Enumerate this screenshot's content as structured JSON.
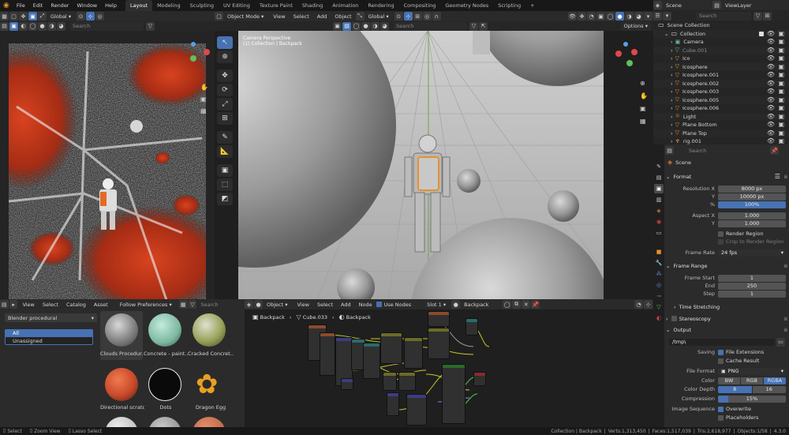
{
  "topbar": {
    "menus": [
      "File",
      "Edit",
      "Render",
      "Window",
      "Help"
    ],
    "workspaces": [
      "Layout",
      "Modeling",
      "Sculpting",
      "UV Editing",
      "Texture Paint",
      "Shading",
      "Animation",
      "Rendering",
      "Compositing",
      "Geometry Nodes",
      "Scripting"
    ],
    "plus": "+",
    "scene": "Scene",
    "view_layer": "ViewLayer"
  },
  "image_editor": {
    "orientation": "Global",
    "search_placeholder": "Search"
  },
  "viewport": {
    "mode": "Object Mode",
    "menus": [
      "View",
      "Select",
      "Add",
      "Object"
    ],
    "orientation": "Global",
    "search_placeholder": "Search",
    "options": "Options",
    "overlay_title": "Camera Perspective",
    "overlay_subtitle": "(1) Collection | Backpack"
  },
  "asset_browser": {
    "menus": [
      "View",
      "Select",
      "Catalog",
      "Asset"
    ],
    "follow_prefs": "Follow Preferences",
    "search_placeholder": "Search",
    "library": "Blender procedural",
    "catalogs": [
      "All",
      "Unassigned"
    ],
    "assets": [
      {
        "name": "Clouds Procedur...",
        "color": "#9a9a9a"
      },
      {
        "name": "Concrete - paint...",
        "color": "#8fc7b0"
      },
      {
        "name": "Cracked Concret...",
        "color": "#9aa35a"
      },
      {
        "name": "Directional scratc...",
        "color": "#c94a2a"
      },
      {
        "name": "Dots",
        "color": "#111111"
      },
      {
        "name": "Dragon Egg",
        "color": "#e8a020"
      }
    ]
  },
  "node_editor": {
    "type": "Object",
    "menus": [
      "View",
      "Select",
      "Add",
      "Node"
    ],
    "use_nodes": "Use Nodes",
    "slot": "Slot 1",
    "material": "Backpack",
    "breadcrumbs": [
      "Backpack",
      "Cube.033",
      "Backpack"
    ]
  },
  "outliner": {
    "search_placeholder": "Search",
    "root": "Scene Collection",
    "collection": "Collection",
    "items": [
      {
        "name": "Camera",
        "icon": "camera-icon",
        "color": "#6fb4a3"
      },
      {
        "name": "Cube.001",
        "icon": "mesh-icon",
        "color": "#6fb4a3",
        "dim": true
      },
      {
        "name": "Ico",
        "icon": "mesh-icon",
        "color": "#e8902e"
      },
      {
        "name": "Icosphere",
        "icon": "mesh-icon",
        "color": "#e8902e"
      },
      {
        "name": "Icosphere.001",
        "icon": "mesh-icon",
        "color": "#e8902e"
      },
      {
        "name": "Icosphere.002",
        "icon": "mesh-icon",
        "color": "#e8902e"
      },
      {
        "name": "Icosphere.003",
        "icon": "mesh-icon",
        "color": "#e8902e"
      },
      {
        "name": "Icosphere.005",
        "icon": "mesh-icon",
        "color": "#e8902e"
      },
      {
        "name": "Icosphere.006",
        "icon": "mesh-icon",
        "color": "#e8902e"
      },
      {
        "name": "Light",
        "icon": "light-icon",
        "color": "#e8902e"
      },
      {
        "name": "Plane Bottom",
        "icon": "mesh-icon",
        "color": "#e8902e"
      },
      {
        "name": "Plane Top",
        "icon": "mesh-icon",
        "color": "#e8902e"
      },
      {
        "name": "rig.001",
        "icon": "armature-icon",
        "color": "#e8902e"
      }
    ]
  },
  "properties": {
    "search_placeholder": "Search",
    "breadcrumb": "Scene",
    "format": {
      "title": "Format",
      "resolution_x_label": "Resolution X",
      "resolution_x": "8000 px",
      "y_label": "Y",
      "resolution_y": "10000 px",
      "pct_label": "%",
      "resolution_pct": "100%",
      "aspect_x_label": "Aspect X",
      "aspect_x": "1.000",
      "aspect_y_label": "Y",
      "aspect_y": "1.000",
      "render_region": "Render Region",
      "crop": "Crop to Render Region",
      "frame_rate_label": "Frame Rate",
      "frame_rate": "24 fps"
    },
    "frame_range": {
      "title": "Frame Range",
      "start_label": "Frame Start",
      "start": "1",
      "end_label": "End",
      "end": "250",
      "step_label": "Step",
      "step": "1"
    },
    "time_stretching": "Time Stretching",
    "stereoscopy": "Stereoscopy",
    "output": {
      "title": "Output",
      "path": "/tmp\\",
      "saving_label": "Saving",
      "file_extensions": "File Extensions",
      "cache_result": "Cache Result",
      "file_format_label": "File Format",
      "file_format": "PNG",
      "color_label": "Color",
      "color_options": [
        "BW",
        "RGB",
        "RGBA"
      ],
      "depth_label": "Color Depth",
      "depth_options": [
        "8",
        "16"
      ],
      "compression_label": "Compression",
      "compression": "15%",
      "image_seq_label": "Image Sequence",
      "overwrite": "Overwrite",
      "placeholders": "Placeholders"
    }
  },
  "status": {
    "select": "Select",
    "zoom": "Zoom View",
    "lasso": "Lasso Select",
    "collection": "Collection | Backpack",
    "verts": "Verts:1,313,450",
    "faces": "Faces:1,517,039",
    "tris": "Tris:2,618,977",
    "objects": "Objects:1/58",
    "version": "4.3.0"
  },
  "colors": {
    "accent": "#4772b3",
    "orange": "#e8902e",
    "red_nebula": "#c9391f"
  }
}
